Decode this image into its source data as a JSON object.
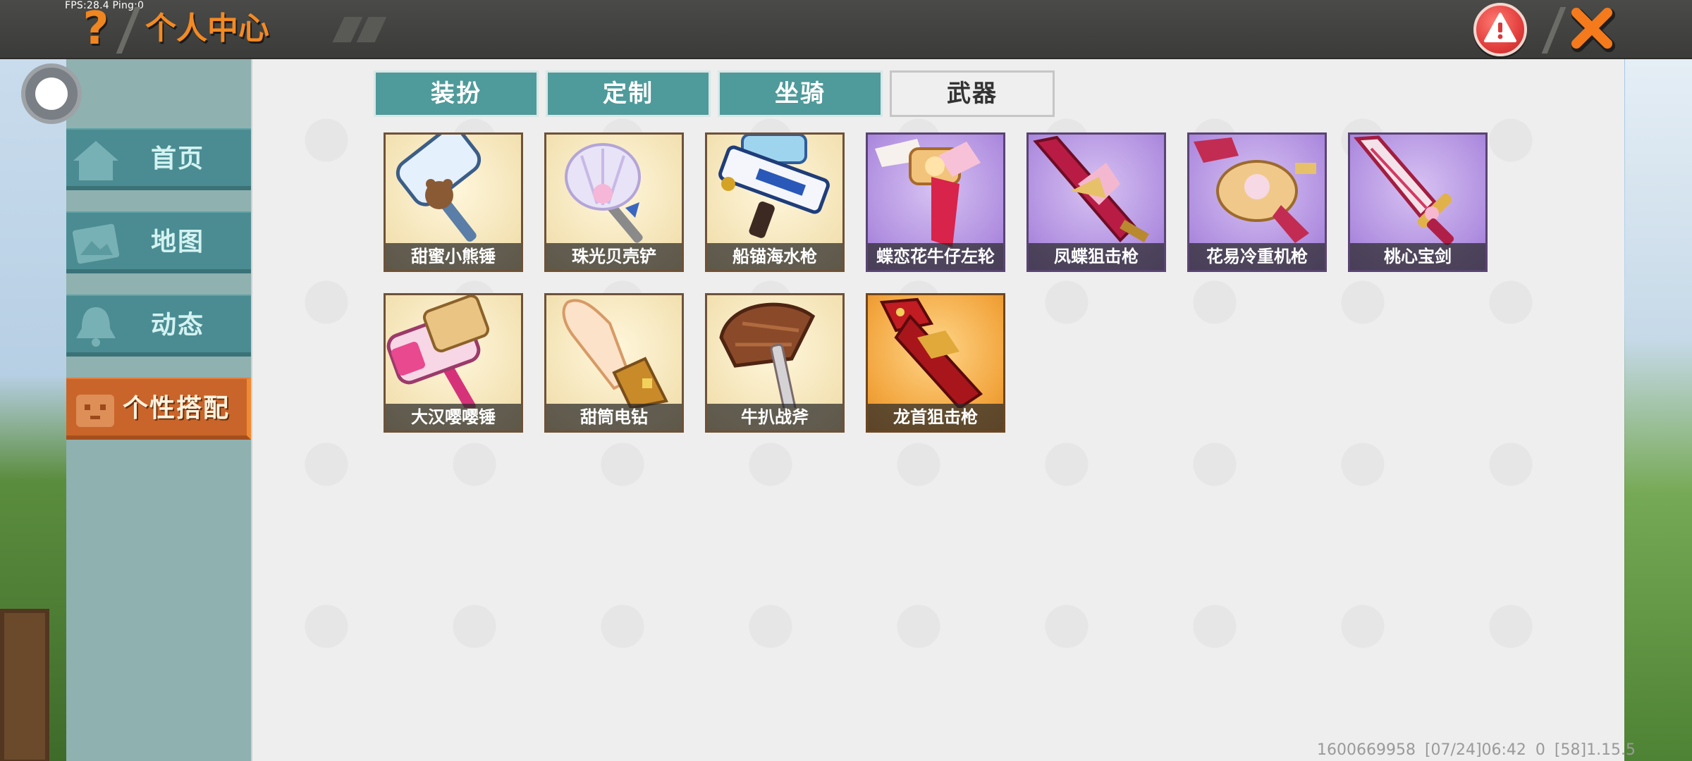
{
  "debug": {
    "text": "FPS:28.4  Ping:0"
  },
  "header": {
    "title": "个人中心",
    "help_icon": "?"
  },
  "colors": {
    "accent": "#f48a22",
    "tab": "#4f9a9a",
    "sidebar_item": "#4a8c92",
    "active_item": "#c9652a"
  },
  "sidebar": {
    "items": [
      {
        "label": "首页",
        "icon": "home-icon"
      },
      {
        "label": "地图",
        "icon": "map-icon"
      },
      {
        "label": "动态",
        "icon": "bell-icon"
      },
      {
        "label": "个性搭配",
        "icon": "avatar-icon",
        "active": true
      }
    ]
  },
  "tabs": [
    {
      "label": "装扮"
    },
    {
      "label": "定制"
    },
    {
      "label": "坐骑"
    },
    {
      "label": "武器",
      "active": true
    }
  ],
  "weapons": [
    {
      "name": "甜蜜小熊锤",
      "rarity": "beige"
    },
    {
      "name": "珠光贝壳铲",
      "rarity": "beige"
    },
    {
      "name": "船锚海水枪",
      "rarity": "beige"
    },
    {
      "name": "蝶恋花牛仔左轮",
      "rarity": "purple"
    },
    {
      "name": "凤蝶狙击枪",
      "rarity": "purple"
    },
    {
      "name": "花易冷重机枪",
      "rarity": "purple"
    },
    {
      "name": "桃心宝剑",
      "rarity": "purple"
    },
    {
      "name": "大汉嘤嘤锤",
      "rarity": "beige"
    },
    {
      "name": "甜筒电钻",
      "rarity": "beige"
    },
    {
      "name": "牛扒战斧",
      "rarity": "beige"
    },
    {
      "name": "龙首狙击枪",
      "rarity": "orange"
    }
  ],
  "footer": {
    "text": "1600669958   [07/24]06:42 0  [58]1.15.5"
  }
}
